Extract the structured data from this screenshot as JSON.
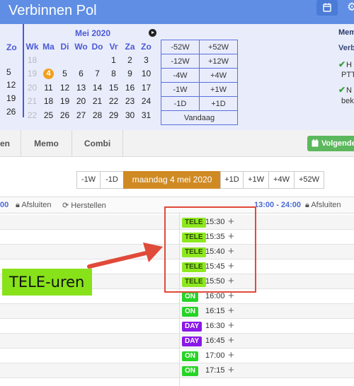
{
  "header": {
    "title": "Verbinnen Pol"
  },
  "calendar": {
    "month_label": "Mei 2020",
    "left_col_header": "Zo",
    "left_col_values": [
      "5",
      "12",
      "19",
      "26"
    ],
    "weekday_headers": [
      "Wk",
      "Ma",
      "Di",
      "Wo",
      "Do",
      "Vr",
      "Za",
      "Zo"
    ],
    "weeks": [
      {
        "wk": "18",
        "days": [
          "",
          "",
          "",
          "",
          "1",
          "2",
          "3"
        ]
      },
      {
        "wk": "19",
        "days": [
          "4",
          "5",
          "6",
          "7",
          "8",
          "9",
          "10"
        ]
      },
      {
        "wk": "20",
        "days": [
          "11",
          "12",
          "13",
          "14",
          "15",
          "16",
          "17"
        ]
      },
      {
        "wk": "21",
        "days": [
          "18",
          "19",
          "20",
          "21",
          "22",
          "23",
          "24"
        ]
      },
      {
        "wk": "22",
        "days": [
          "25",
          "26",
          "27",
          "28",
          "29",
          "30",
          "31"
        ]
      }
    ],
    "today": "4"
  },
  "jump": {
    "rows": [
      [
        "-52W",
        "+52W"
      ],
      [
        "-12W",
        "+12W"
      ],
      [
        "-4W",
        "+4W"
      ],
      [
        "-1W",
        "+1W"
      ],
      [
        "-1D",
        "+1D"
      ]
    ],
    "today_label": "Vandaag"
  },
  "right_info": {
    "line1": "Mem",
    "line2": "Verb",
    "item1": "H",
    "item1b": "PTT",
    "item2": "N",
    "item2b": "bek"
  },
  "tabs": {
    "items": [
      "en",
      "Memo",
      "Combi"
    ],
    "next_button": "Volgende"
  },
  "datenav": {
    "buttons_left": [
      "-1W",
      "-1D"
    ],
    "current": "maandag 4 mei 2020",
    "buttons_right": [
      "+1D",
      "+1W",
      "+4W",
      "+52W"
    ]
  },
  "section": {
    "left_time": "00",
    "close_label": "Afsluiten",
    "restore_label": "Herstellen",
    "range": "13:00 - 24:00",
    "close_label_right": "Afsluiten"
  },
  "slots": [
    {
      "badge": "TELE",
      "kind": "tele",
      "time": "15:30"
    },
    {
      "badge": "TELE",
      "kind": "tele",
      "time": "15:35"
    },
    {
      "badge": "TELE",
      "kind": "tele",
      "time": "15:40"
    },
    {
      "badge": "TELE",
      "kind": "tele",
      "time": "15:45"
    },
    {
      "badge": "TELE",
      "kind": "tele",
      "time": "15:50"
    },
    {
      "badge": "ON",
      "kind": "on",
      "time": "16:00"
    },
    {
      "badge": "ON",
      "kind": "on",
      "time": "16:15"
    },
    {
      "badge": "DAY",
      "kind": "day",
      "time": "16:30"
    },
    {
      "badge": "DAY",
      "kind": "day",
      "time": "16:45"
    },
    {
      "badge": "ON",
      "kind": "on",
      "time": "17:00"
    },
    {
      "badge": "ON",
      "kind": "on",
      "time": "17:15"
    }
  ],
  "annotation": {
    "label": "TELE-uren",
    "color_box": "#e04a3a",
    "color_label": "#88e21a"
  },
  "colors": {
    "header": "#5f8ee4",
    "accent_blue": "#4a5ad6",
    "today": "#f0a020",
    "current_date": "#d08a23",
    "tele": "#8de81e",
    "on": "#26d426",
    "day": "#8a18e8",
    "next_button": "#5cb85c"
  }
}
